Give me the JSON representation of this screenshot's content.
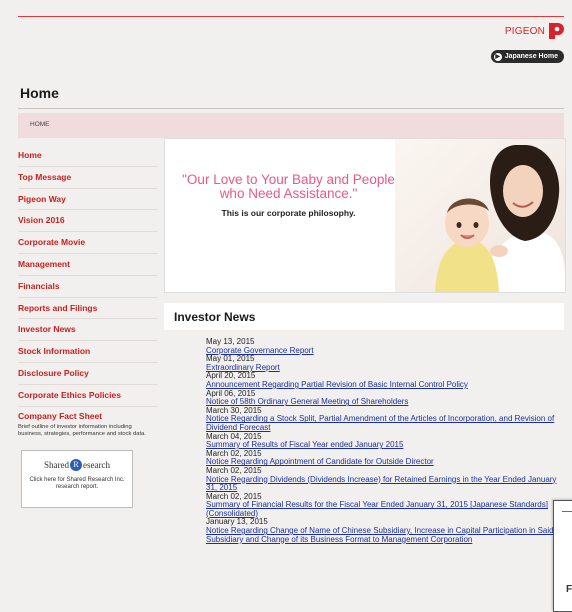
{
  "header": {
    "logo_text": "PIGEON",
    "japanese_home_label": "Japanese Home",
    "brand_color": "#d8212a"
  },
  "page": {
    "title": "Home",
    "breadcrumb": "HOME"
  },
  "sidebar": {
    "items": [
      {
        "label": "Home"
      },
      {
        "label": "Top Message"
      },
      {
        "label": "Pigeon Way"
      },
      {
        "label": "Vision 2016"
      },
      {
        "label": "Corporate Movie"
      },
      {
        "label": "Management"
      },
      {
        "label": "Financials"
      },
      {
        "label": "Reports and Filings"
      },
      {
        "label": "Investor News"
      },
      {
        "label": "Stock Information"
      },
      {
        "label": "Disclosure Policy"
      },
      {
        "label": "Corporate Ethics Policies"
      }
    ],
    "fact_sheet": {
      "title": "Company Fact Sheet",
      "description": "Brief outline of investor information including business, strategies, performance and stock data."
    },
    "shared_research": {
      "logo_left": "Shared",
      "logo_r": "R",
      "logo_right": "esearch",
      "text": "Click here for Shared Research Inc. research report."
    }
  },
  "banner": {
    "headline": "\"Our Love to Your Baby and People who Need Assistance.\"",
    "subline": "This is our corporate philosophy."
  },
  "investor_news": {
    "title": "Investor News",
    "items": [
      {
        "date": "May 13, 2015",
        "title": "Corporate Governance Report"
      },
      {
        "date": "May 01, 2015",
        "title": "Extraordinary Report"
      },
      {
        "date": "April 20, 2015",
        "title": "Announcement Regarding Partial Revision of Basic Internal Control Policy"
      },
      {
        "date": "April 06, 2015",
        "title": "Notice of 58th Ordinary General Meeting of Shareholders"
      },
      {
        "date": "March 30, 2015",
        "title": "Notice Regarding a Stock Split, Partial Amendment of the Articles of Incorporation, and Revision of Dividend Forecast"
      },
      {
        "date": "March 04, 2015",
        "title": "Summary of Results of Fiscal Year ended January 2015"
      },
      {
        "date": "March 02, 2015",
        "title": "Notice Regarding Appointment of Candidate for Outside Director"
      },
      {
        "date": "March 02, 2015",
        "title": "Notice Regarding Dividends (Dividends Increase) for Retained Earnings in the Year Ended January 31, 2015"
      },
      {
        "date": "March 02, 2015",
        "title": "Summary of Financial Results for the Fiscal Year Ended January 31, 2015 [Japanese Standards] (Consolidated)"
      },
      {
        "date": "January 13, 2015",
        "title": "Notice Regarding Change of Name of Chinese Subsidiary, Increase in Capital Participation in Said Subsidiary and Change of its Business Format to Management Corporation"
      }
    ]
  },
  "popup": {
    "letter": "F"
  }
}
